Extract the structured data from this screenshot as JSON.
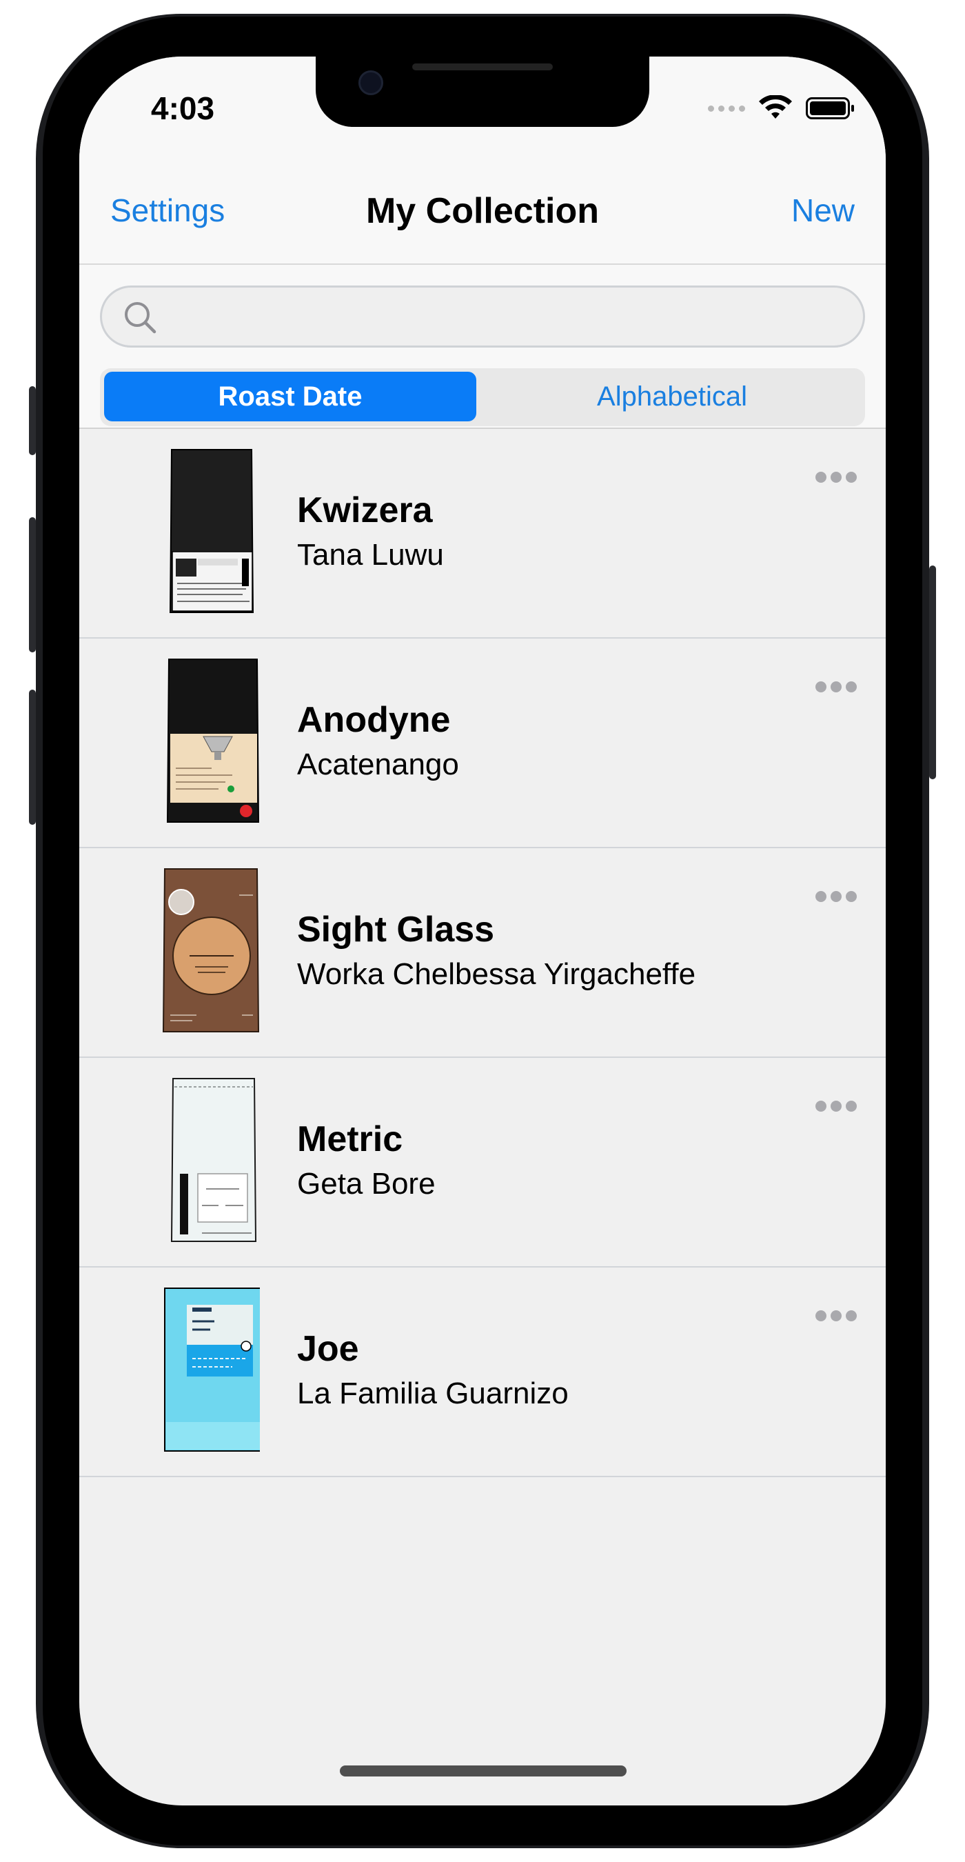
{
  "status_bar": {
    "time": "4:03"
  },
  "nav": {
    "left_label": "Settings",
    "title": "My Collection",
    "right_label": "New"
  },
  "search": {
    "placeholder": ""
  },
  "segmented": {
    "options": [
      "Roast Date",
      "Alphabetical"
    ],
    "selected": "Roast Date"
  },
  "coffees": [
    {
      "roaster": "Kwizera",
      "name": "Tana Luwu",
      "bag": "black-white-label"
    },
    {
      "roaster": "Anodyne",
      "name": "Acatenango",
      "bag": "black-cream-label"
    },
    {
      "roaster": "Sight Glass",
      "name": "Worka Chelbessa Yirgacheffe",
      "bag": "brown-circle"
    },
    {
      "roaster": "Metric",
      "name": "Geta Bore",
      "bag": "white-vertical-text"
    },
    {
      "roaster": "Joe",
      "name": "La Familia Guarnizo",
      "bag": "blue-box"
    }
  ],
  "colors": {
    "accent": "#1a7fe0",
    "segment_active": "#0a7cf7",
    "list_background": "#f0f0f0",
    "separator": "#d2d5d9"
  }
}
